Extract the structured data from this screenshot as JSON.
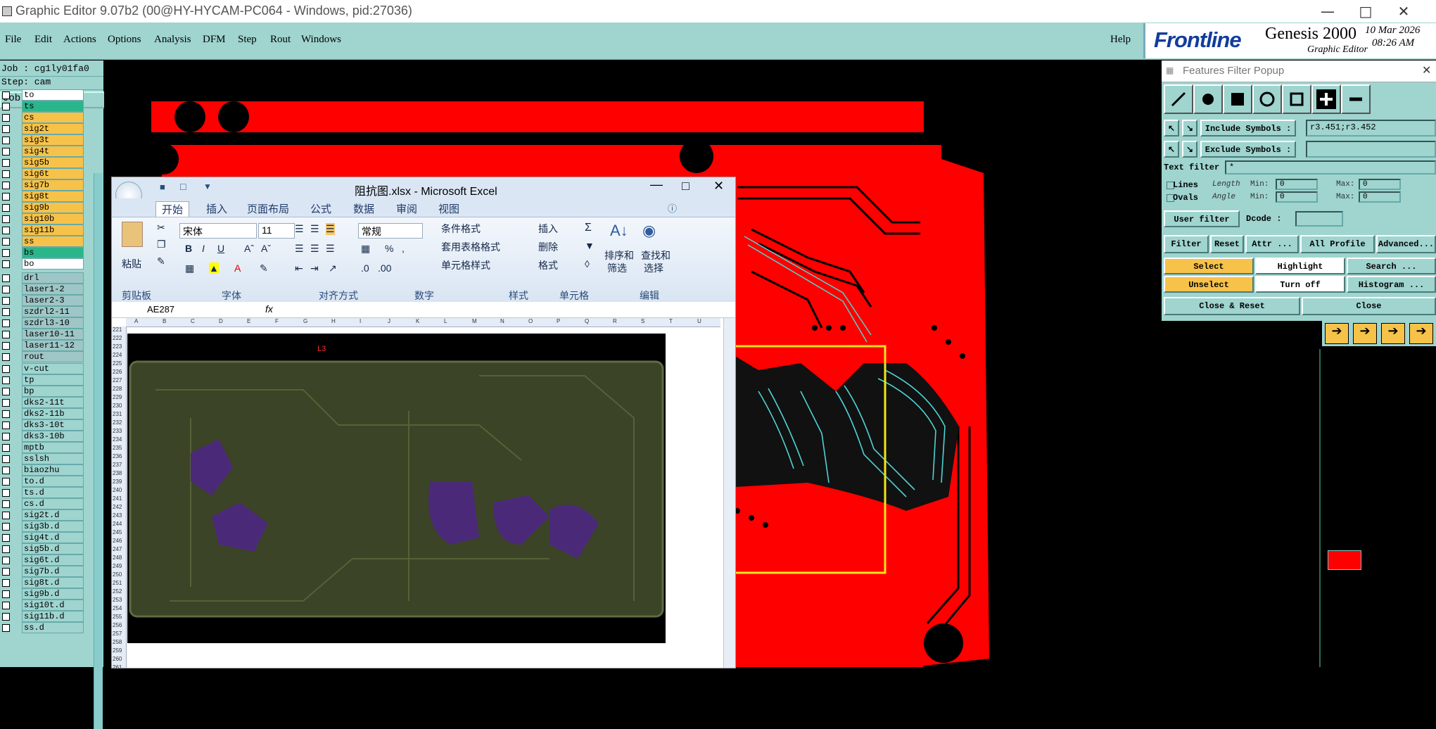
{
  "window": {
    "title": "Graphic Editor 9.07b2 (00@HY-HYCAM-PC064 - Windows, pid:27036)"
  },
  "menu": [
    "File",
    "Edit",
    "Actions",
    "Options",
    "Analysis",
    "DFM",
    "Step",
    "Rout",
    "Windows"
  ],
  "help_label": "Help",
  "brand": {
    "logo": "Frontline",
    "product": "Genesis 2000",
    "subtitle": "Graphic Editor",
    "date": "10 Mar 2026",
    "time": "08:26 AM"
  },
  "job": {
    "job_line": "Job : cg1ly01fa0",
    "step_line": "Step: cam",
    "matrix_button": "Job Matrix ..."
  },
  "layers_group1": [
    {
      "name": "to",
      "color": "#ffffff"
    },
    {
      "name": "ts",
      "color": "#2bb58a"
    },
    {
      "name": "cs",
      "color": "#f7c24a"
    },
    {
      "name": "sig2t",
      "color": "#f7c24a"
    },
    {
      "name": "sig3t",
      "color": "#f7c24a"
    },
    {
      "name": "sig4t",
      "color": "#f7c24a"
    },
    {
      "name": "sig5b",
      "color": "#f7c24a"
    },
    {
      "name": "sig6t",
      "color": "#f7c24a"
    },
    {
      "name": "sig7b",
      "color": "#f7c24a"
    },
    {
      "name": "sig8t",
      "color": "#f7c24a"
    },
    {
      "name": "sig9b",
      "color": "#f7c24a"
    },
    {
      "name": "sig10b",
      "color": "#f7c24a"
    },
    {
      "name": "sig11b",
      "color": "#f7c24a"
    },
    {
      "name": "ss",
      "color": "#f7c24a"
    },
    {
      "name": "bs",
      "color": "#2bb58a"
    },
    {
      "name": "bo",
      "color": "#ffffff"
    }
  ],
  "layers_group2": [
    {
      "name": "drl",
      "color": "#9fc6c6"
    },
    {
      "name": "laser1-2",
      "color": "#9fc6c6"
    },
    {
      "name": "laser2-3",
      "color": "#9fc6c6"
    },
    {
      "name": "szdrl2-11",
      "color": "#9fc6c6"
    },
    {
      "name": "szdrl3-10",
      "color": "#9fc6c6"
    },
    {
      "name": "laser10-11",
      "color": "#9fc6c6"
    },
    {
      "name": "laser11-12",
      "color": "#9fc6c6"
    },
    {
      "name": "rout",
      "color": "#9fc6c6"
    }
  ],
  "layers_group3": [
    {
      "name": "v-cut"
    },
    {
      "name": "tp"
    },
    {
      "name": "bp"
    },
    {
      "name": "dks2-11t"
    },
    {
      "name": "dks2-11b"
    },
    {
      "name": "dks3-10t"
    },
    {
      "name": "dks3-10b"
    },
    {
      "name": "mptb"
    },
    {
      "name": "sslsh"
    },
    {
      "name": "biaozhu"
    },
    {
      "name": "to.d"
    },
    {
      "name": "ts.d"
    },
    {
      "name": "cs.d"
    },
    {
      "name": "sig2t.d"
    },
    {
      "name": "sig3b.d"
    },
    {
      "name": "sig4t.d"
    },
    {
      "name": "sig5b.d"
    },
    {
      "name": "sig6t.d"
    },
    {
      "name": "sig7b.d"
    },
    {
      "name": "sig8t.d"
    },
    {
      "name": "sig9b.d"
    },
    {
      "name": "sig10t.d"
    },
    {
      "name": "sig11b.d"
    },
    {
      "name": "ss.d"
    }
  ],
  "excel": {
    "title": "阻抗图.xlsx - Microsoft Excel",
    "tabs": [
      "开始",
      "插入",
      "页面布局",
      "公式",
      "数据",
      "审阅",
      "视图"
    ],
    "groups": [
      "剪贴板",
      "字体",
      "对齐方式",
      "数字",
      "样式",
      "单元格",
      "编辑"
    ],
    "paste": "粘贴",
    "font_name": "宋体",
    "font_size": "11",
    "number_format": "常规",
    "style_items": [
      "条件格式",
      "套用表格格式",
      "单元格样式"
    ],
    "cell_items": [
      "插入",
      "删除",
      "格式"
    ],
    "edit_items": [
      "排序和",
      "筛选",
      "查找和",
      "选择"
    ],
    "name_box": "AE287",
    "fx": "fx",
    "sheet_label": "L3",
    "row_numbers": [
      "221",
      "222",
      "223",
      "224",
      "225",
      "226",
      "227",
      "228",
      "229",
      "230",
      "231",
      "232",
      "233",
      "234",
      "235",
      "236",
      "237",
      "238",
      "239",
      "240",
      "241",
      "242",
      "243",
      "244",
      "245",
      "246",
      "247",
      "248",
      "249",
      "250",
      "251",
      "252",
      "253",
      "254",
      "255",
      "256",
      "257",
      "258",
      "259",
      "260",
      "261"
    ],
    "col_letters": [
      "A",
      "B",
      "C",
      "D",
      "E",
      "F",
      "G",
      "H",
      "I",
      "J",
      "K",
      "L",
      "M",
      "N",
      "O",
      "P",
      "Q",
      "R",
      "S",
      "T",
      "U"
    ]
  },
  "popup": {
    "title": "Features Filter Popup",
    "include_label": "Include Symbols :",
    "include_value": "r3.451;r3.452",
    "exclude_label": "Exclude Symbols :",
    "exclude_value": "",
    "text_filter_label": "Text filter",
    "text_filter_value": "*",
    "lines_label": "Lines",
    "ovals_label": "Ovals",
    "length_label": "Length",
    "angle_label": "Angle",
    "min_label": "Min:",
    "max_label": "Max:",
    "min_val": "0",
    "max_val": "0",
    "user_filter": "User filter ...",
    "dcode_label": "Dcode :",
    "filter_btn": "Filter",
    "reset_btn": "Reset",
    "attr_btn": "Attr ...",
    "profile_btn": "All Profile",
    "advanced_btn": "Advanced...",
    "select_btn": "Select",
    "highlight_btn": "Highlight",
    "search_btn": "Search ...",
    "unselect_btn": "Unselect",
    "turnoff_btn": "Turn off",
    "histogram_btn": "Histogram ...",
    "close_reset_btn": "Close & Reset",
    "close_btn": "Close"
  },
  "colors": {
    "board": "#ff0000",
    "highlight_box": "#f1e51b",
    "panel": "#9fd4cf",
    "select_btn": "#f7c24a"
  }
}
